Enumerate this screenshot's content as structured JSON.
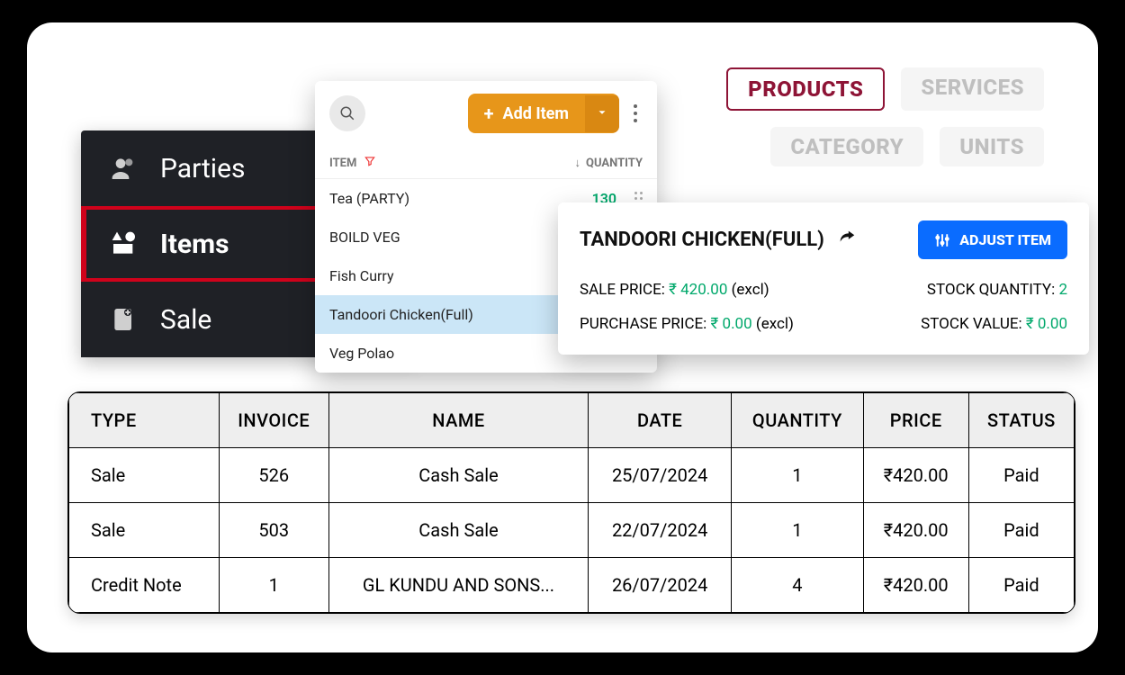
{
  "filters": {
    "products": "PRODUCTS",
    "services": "SERVICES",
    "category": "CATEGORY",
    "units": "UNITS"
  },
  "sidebar": {
    "parties": "Parties",
    "items": "Items",
    "sale": "Sale"
  },
  "item_list": {
    "add_item": "Add Item",
    "header_item": "ITEM",
    "header_qty": "QUANTITY",
    "rows": [
      {
        "name": "Tea (PARTY)",
        "qty": "130"
      },
      {
        "name": "BOILD VEG",
        "qty": ""
      },
      {
        "name": "Fish Curry",
        "qty": ""
      },
      {
        "name": "Tandoori Chicken(Full)",
        "qty": ""
      },
      {
        "name": "Veg Polao",
        "qty": ""
      }
    ]
  },
  "detail": {
    "title": "TANDOORI CHICKEN(FULL)",
    "adjust": "ADJUST ITEM",
    "sale_price_label": "SALE PRICE: ",
    "sale_price_value": "₹ 420.00",
    "sale_price_suffix": " (excl)",
    "stock_qty_label": "STOCK QUANTITY: ",
    "stock_qty_value": "2",
    "purchase_price_label": "PURCHASE PRICE: ",
    "purchase_price_value": "₹ 0.00",
    "purchase_price_suffix": " (excl)",
    "stock_value_label": "STOCK VALUE: ",
    "stock_value_value": "₹ 0.00"
  },
  "tx": {
    "headers": {
      "type": "TYPE",
      "invoice": "INVOICE",
      "name": "NAME",
      "date": "DATE",
      "quantity": "QUANTITY",
      "price": "PRICE",
      "status": "STATUS"
    },
    "rows": [
      {
        "type": "Sale",
        "invoice": "526",
        "name": "Cash Sale",
        "date": "25/07/2024",
        "qty": "1",
        "price": "₹420.00",
        "status": "Paid"
      },
      {
        "type": "Sale",
        "invoice": "503",
        "name": "Cash Sale",
        "date": "22/07/2024",
        "qty": "1",
        "price": "₹420.00",
        "status": "Paid"
      },
      {
        "type": "Credit Note",
        "invoice": "1",
        "name": "GL KUNDU AND SONS...",
        "date": "26/07/2024",
        "qty": "4",
        "price": "₹420.00",
        "status": "Paid"
      }
    ]
  }
}
